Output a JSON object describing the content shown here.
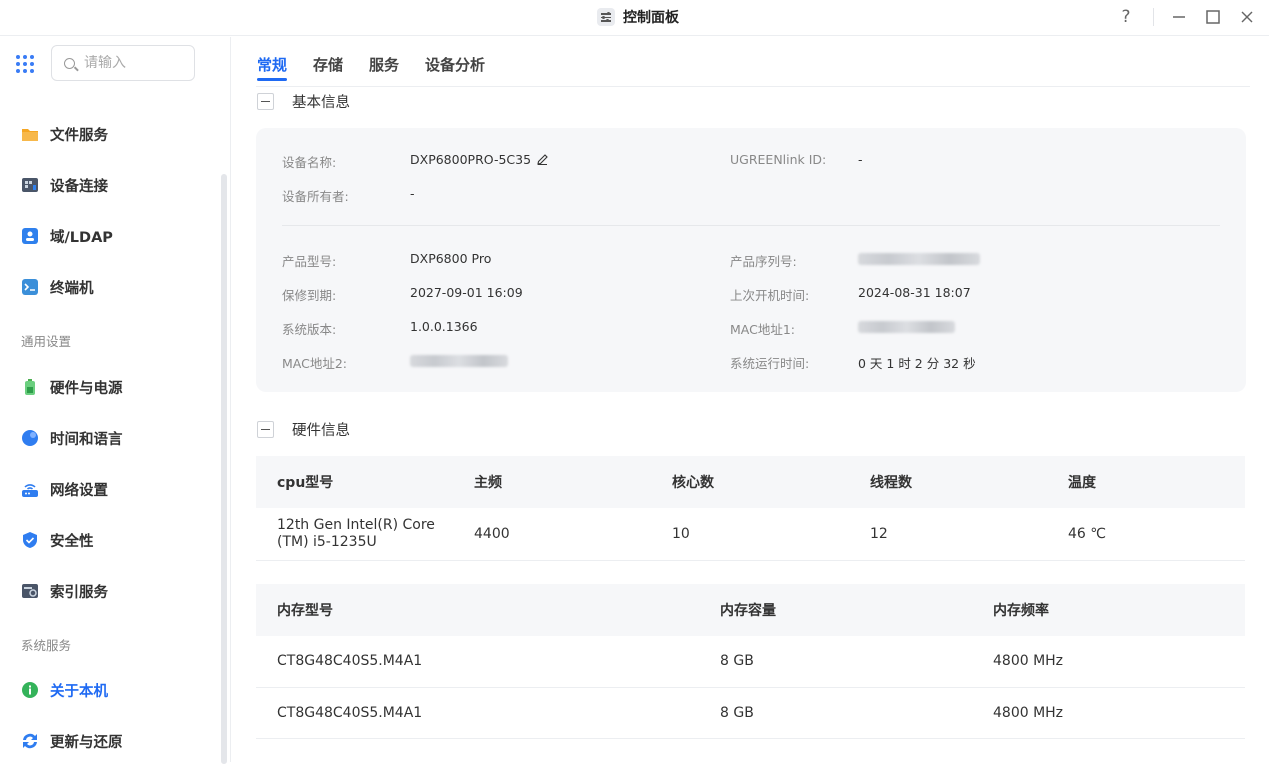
{
  "window": {
    "title": "控制面板",
    "help_icon": "question-icon",
    "minimize_icon": "minimize-icon",
    "maximize_icon": "maximize-icon",
    "close_icon": "close-icon"
  },
  "sidebar": {
    "search_placeholder": "请输入",
    "sections": [
      {
        "label": "",
        "items": [
          {
            "label": "文件服务",
            "icon": "folder-icon",
            "color": "#f5a623"
          },
          {
            "label": "设备连接",
            "icon": "device-connect-icon",
            "color": "#4a5568"
          },
          {
            "label": "域/LDAP",
            "icon": "ldap-icon",
            "color": "#2f80ed"
          },
          {
            "label": "终端机",
            "icon": "terminal-icon",
            "color": "#3b8fd9"
          }
        ]
      },
      {
        "label": "通用设置",
        "items": [
          {
            "label": "硬件与电源",
            "icon": "battery-icon",
            "color": "#4caf50"
          },
          {
            "label": "时间和语言",
            "icon": "globe-icon",
            "color": "#2f7df0"
          },
          {
            "label": "网络设置",
            "icon": "router-icon",
            "color": "#2f7df0"
          },
          {
            "label": "安全性",
            "icon": "shield-icon",
            "color": "#2f7df0"
          },
          {
            "label": "索引服务",
            "icon": "index-icon",
            "color": "#4a5568"
          }
        ]
      },
      {
        "label": "系统服务",
        "items": [
          {
            "label": "关于本机",
            "icon": "info-icon",
            "color": "#34b35a",
            "active": true
          },
          {
            "label": "更新与还原",
            "icon": "sync-icon",
            "color": "#2f7df0"
          }
        ]
      }
    ]
  },
  "tabs": [
    "常规",
    "存储",
    "服务",
    "设备分析"
  ],
  "active_tab": "常规",
  "basic_info": {
    "title": "基本信息",
    "device_name_label": "设备名称:",
    "device_name": "DXP6800PRO-5C35",
    "ugreenlink_label": "UGREENlink ID:",
    "ugreenlink": "-",
    "owner_label": "设备所有者:",
    "owner": "-",
    "model_label": "产品型号:",
    "model": "DXP6800 Pro",
    "serial_label": "产品序列号:",
    "warranty_label": "保修到期:",
    "warranty": "2027-09-01 16:09",
    "last_boot_label": "上次开机时间:",
    "last_boot": "2024-08-31 18:07",
    "version_label": "系统版本:",
    "version": "1.0.0.1366",
    "mac1_label": "MAC地址1:",
    "mac2_label": "MAC地址2:",
    "uptime_label": "系统运行时间:",
    "uptime": "0 天 1 时 2 分 32 秒"
  },
  "hardware_info": {
    "title": "硬件信息",
    "cpu_headers": [
      "cpu型号",
      "主频",
      "核心数",
      "线程数",
      "温度"
    ],
    "cpu_rows": [
      [
        "12th Gen Intel(R) Core (TM) i5-1235U",
        "4400",
        "10",
        "12",
        "46 ℃"
      ]
    ],
    "mem_headers": [
      "内存型号",
      "内存容量",
      "内存频率"
    ],
    "mem_rows": [
      [
        "CT8G48C40S5.M4A1",
        "8 GB",
        "4800 MHz"
      ],
      [
        "CT8G48C40S5.M4A1",
        "8 GB",
        "4800 MHz"
      ]
    ]
  }
}
